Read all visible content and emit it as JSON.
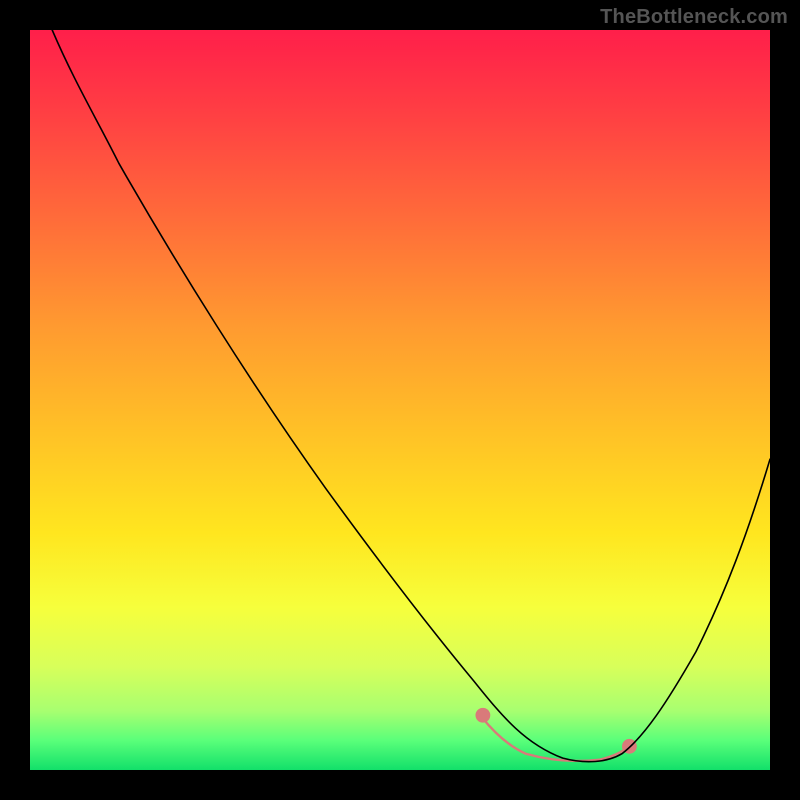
{
  "watermark": "TheBottleneck.com",
  "chart_data": {
    "type": "line",
    "title": "",
    "xlabel": "",
    "ylabel": "",
    "xlim": [
      0,
      100
    ],
    "ylim": [
      0,
      100
    ],
    "x": [
      3,
      8,
      15,
      25,
      35,
      45,
      55,
      62,
      66,
      70,
      74,
      78,
      80,
      84,
      90,
      96,
      100
    ],
    "y": [
      100,
      90,
      78,
      62,
      46,
      31,
      18,
      9,
      4,
      2,
      1,
      1,
      2,
      6,
      16,
      30,
      42
    ],
    "marker_region_x_range": [
      62,
      80
    ],
    "marker_color": "#d97a7a",
    "line_color": "#000000",
    "background_gradient_stops": [
      {
        "pos": 0.0,
        "color": "#ff1f4a"
      },
      {
        "pos": 0.55,
        "color": "#ffc326"
      },
      {
        "pos": 0.78,
        "color": "#f6ff3c"
      },
      {
        "pos": 1.0,
        "color": "#12e06a"
      }
    ]
  }
}
